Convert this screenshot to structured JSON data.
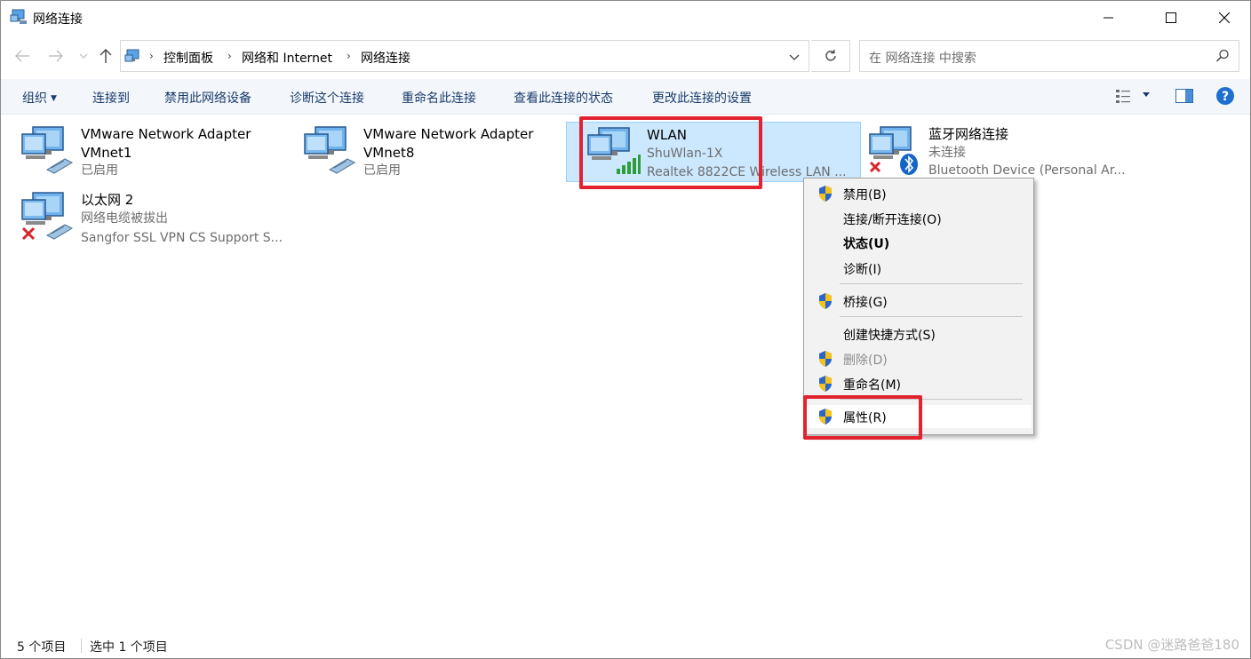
{
  "window": {
    "title": "网络连接"
  },
  "address": {
    "crumbs": [
      "控制面板",
      "网络和 Internet",
      "网络连接"
    ]
  },
  "search": {
    "placeholder": "在 网络连接 中搜索"
  },
  "commands": {
    "organize": "组织",
    "connect": "连接到",
    "disable": "禁用此网络设备",
    "diagnose": "诊断这个连接",
    "rename": "重命名此连接",
    "status": "查看此连接的状态",
    "settings": "更改此连接的设置"
  },
  "connections": [
    {
      "name": "VMware Network Adapter",
      "line2": "VMnet1",
      "line3": "已启用",
      "icon": "network-adapter-icon"
    },
    {
      "name": "VMware Network Adapter",
      "line2": "VMnet8",
      "line3": "已启用",
      "icon": "network-adapter-icon"
    },
    {
      "name": "WLAN",
      "line2": "ShuWlan-1X",
      "line3": "Realtek 8822CE Wireless LAN ...",
      "icon": "wifi-adapter-icon",
      "selected": true
    },
    {
      "name": "蓝牙网络连接",
      "line2": "未连接",
      "line3": "Bluetooth Device (Personal Ar...",
      "icon": "bluetooth-adapter-icon"
    },
    {
      "name": "以太网 2",
      "line2": "网络电缆被拔出",
      "line3": "Sangfor SSL VPN CS Support S...",
      "icon": "ethernet-adapter-icon"
    }
  ],
  "context_menu": {
    "items": [
      {
        "label": "禁用(B)",
        "shield": true
      },
      {
        "label": "连接/断开连接(O)",
        "shield": false
      },
      {
        "label": "状态(U)",
        "shield": false,
        "bold": true
      },
      {
        "label": "诊断(I)",
        "shield": false
      },
      {
        "label": "桥接(G)",
        "shield": true
      },
      {
        "label": "创建快捷方式(S)",
        "shield": false
      },
      {
        "label": "删除(D)",
        "shield": true,
        "disabled": true
      },
      {
        "label": "重命名(M)",
        "shield": true
      },
      {
        "label": "属性(R)",
        "shield": true,
        "hover": true
      }
    ]
  },
  "status": {
    "count": "5 个项目",
    "selected": "选中 1 个项目"
  },
  "watermark": "CSDN @迷路爸爸180",
  "colors": {
    "highlight_box": "#e3222f",
    "selection_bg": "#cce8ff",
    "command_text": "#1a3b6b",
    "help_blue": "#1f6fd0"
  }
}
